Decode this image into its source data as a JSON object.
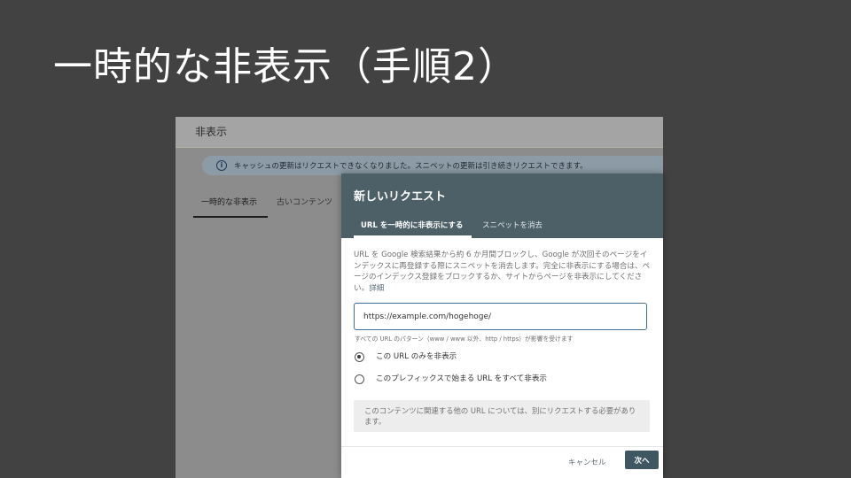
{
  "slide": {
    "title": "一時的な非表示（手順2）"
  },
  "screenshot": {
    "header_title": "非表示",
    "info_banner": "キャッシュの更新はリクエストできなくなりました。スニペットの更新は引き続きリクエストできます。",
    "info_icon": "info-icon",
    "tabs": [
      {
        "label": "一時的な非表示",
        "active": true
      },
      {
        "label": "古いコンテンツ",
        "active": false
      }
    ]
  },
  "dialog": {
    "title": "新しいリクエスト",
    "tabs": [
      {
        "label": "URL を一時的に非表示にする",
        "active": true
      },
      {
        "label": "スニペットを消去",
        "active": false
      }
    ],
    "description": "URL を Google 検索結果から約 6 か月間ブロックし、Google が次回そのページをインデックスに再登録する際にスニペットを消去します。完全に非表示にする場合は、ページのインデックス登録をブロックするか、サイトからページを非表示にしてください。",
    "description_link": "詳細",
    "url_value": "https://example.com/hogehoge/",
    "hint": "すべての URL のパターン（www / www 以外、http / https）が影響を受けます",
    "options": [
      {
        "label": "この URL のみを非表示",
        "checked": true
      },
      {
        "label": "このプレフィックスで始まる URL をすべて非表示",
        "checked": false
      }
    ],
    "note": "このコンテンツに関連する他の URL については、別にリクエストする必要があります。",
    "cancel_label": "キャンセル",
    "next_label": "次へ"
  },
  "colors": {
    "slide_background": "#424242",
    "dialog_header": "#4d6068",
    "primary_button": "#3f5663"
  }
}
